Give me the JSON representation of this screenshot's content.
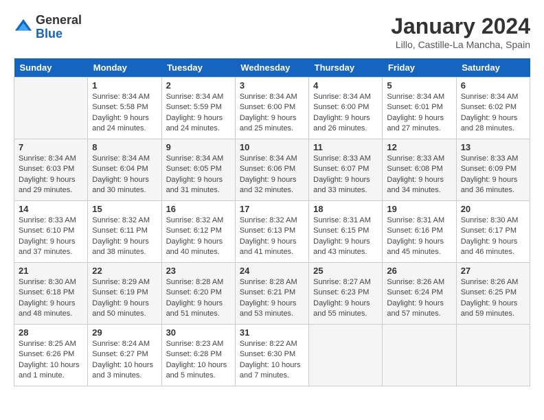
{
  "header": {
    "logo_general": "General",
    "logo_blue": "Blue",
    "title": "January 2024",
    "subtitle": "Lillo, Castille-La Mancha, Spain"
  },
  "calendar": {
    "days_of_week": [
      "Sunday",
      "Monday",
      "Tuesday",
      "Wednesday",
      "Thursday",
      "Friday",
      "Saturday"
    ],
    "weeks": [
      [
        {
          "day": "",
          "sunrise": "",
          "sunset": "",
          "daylight": ""
        },
        {
          "day": "1",
          "sunrise": "Sunrise: 8:34 AM",
          "sunset": "Sunset: 5:58 PM",
          "daylight": "Daylight: 9 hours and 24 minutes."
        },
        {
          "day": "2",
          "sunrise": "Sunrise: 8:34 AM",
          "sunset": "Sunset: 5:59 PM",
          "daylight": "Daylight: 9 hours and 24 minutes."
        },
        {
          "day": "3",
          "sunrise": "Sunrise: 8:34 AM",
          "sunset": "Sunset: 6:00 PM",
          "daylight": "Daylight: 9 hours and 25 minutes."
        },
        {
          "day": "4",
          "sunrise": "Sunrise: 8:34 AM",
          "sunset": "Sunset: 6:00 PM",
          "daylight": "Daylight: 9 hours and 26 minutes."
        },
        {
          "day": "5",
          "sunrise": "Sunrise: 8:34 AM",
          "sunset": "Sunset: 6:01 PM",
          "daylight": "Daylight: 9 hours and 27 minutes."
        },
        {
          "day": "6",
          "sunrise": "Sunrise: 8:34 AM",
          "sunset": "Sunset: 6:02 PM",
          "daylight": "Daylight: 9 hours and 28 minutes."
        }
      ],
      [
        {
          "day": "7",
          "sunrise": "Sunrise: 8:34 AM",
          "sunset": "Sunset: 6:03 PM",
          "daylight": "Daylight: 9 hours and 29 minutes."
        },
        {
          "day": "8",
          "sunrise": "Sunrise: 8:34 AM",
          "sunset": "Sunset: 6:04 PM",
          "daylight": "Daylight: 9 hours and 30 minutes."
        },
        {
          "day": "9",
          "sunrise": "Sunrise: 8:34 AM",
          "sunset": "Sunset: 6:05 PM",
          "daylight": "Daylight: 9 hours and 31 minutes."
        },
        {
          "day": "10",
          "sunrise": "Sunrise: 8:34 AM",
          "sunset": "Sunset: 6:06 PM",
          "daylight": "Daylight: 9 hours and 32 minutes."
        },
        {
          "day": "11",
          "sunrise": "Sunrise: 8:33 AM",
          "sunset": "Sunset: 6:07 PM",
          "daylight": "Daylight: 9 hours and 33 minutes."
        },
        {
          "day": "12",
          "sunrise": "Sunrise: 8:33 AM",
          "sunset": "Sunset: 6:08 PM",
          "daylight": "Daylight: 9 hours and 34 minutes."
        },
        {
          "day": "13",
          "sunrise": "Sunrise: 8:33 AM",
          "sunset": "Sunset: 6:09 PM",
          "daylight": "Daylight: 9 hours and 36 minutes."
        }
      ],
      [
        {
          "day": "14",
          "sunrise": "Sunrise: 8:33 AM",
          "sunset": "Sunset: 6:10 PM",
          "daylight": "Daylight: 9 hours and 37 minutes."
        },
        {
          "day": "15",
          "sunrise": "Sunrise: 8:32 AM",
          "sunset": "Sunset: 6:11 PM",
          "daylight": "Daylight: 9 hours and 38 minutes."
        },
        {
          "day": "16",
          "sunrise": "Sunrise: 8:32 AM",
          "sunset": "Sunset: 6:12 PM",
          "daylight": "Daylight: 9 hours and 40 minutes."
        },
        {
          "day": "17",
          "sunrise": "Sunrise: 8:32 AM",
          "sunset": "Sunset: 6:13 PM",
          "daylight": "Daylight: 9 hours and 41 minutes."
        },
        {
          "day": "18",
          "sunrise": "Sunrise: 8:31 AM",
          "sunset": "Sunset: 6:15 PM",
          "daylight": "Daylight: 9 hours and 43 minutes."
        },
        {
          "day": "19",
          "sunrise": "Sunrise: 8:31 AM",
          "sunset": "Sunset: 6:16 PM",
          "daylight": "Daylight: 9 hours and 45 minutes."
        },
        {
          "day": "20",
          "sunrise": "Sunrise: 8:30 AM",
          "sunset": "Sunset: 6:17 PM",
          "daylight": "Daylight: 9 hours and 46 minutes."
        }
      ],
      [
        {
          "day": "21",
          "sunrise": "Sunrise: 8:30 AM",
          "sunset": "Sunset: 6:18 PM",
          "daylight": "Daylight: 9 hours and 48 minutes."
        },
        {
          "day": "22",
          "sunrise": "Sunrise: 8:29 AM",
          "sunset": "Sunset: 6:19 PM",
          "daylight": "Daylight: 9 hours and 50 minutes."
        },
        {
          "day": "23",
          "sunrise": "Sunrise: 8:28 AM",
          "sunset": "Sunset: 6:20 PM",
          "daylight": "Daylight: 9 hours and 51 minutes."
        },
        {
          "day": "24",
          "sunrise": "Sunrise: 8:28 AM",
          "sunset": "Sunset: 6:21 PM",
          "daylight": "Daylight: 9 hours and 53 minutes."
        },
        {
          "day": "25",
          "sunrise": "Sunrise: 8:27 AM",
          "sunset": "Sunset: 6:23 PM",
          "daylight": "Daylight: 9 hours and 55 minutes."
        },
        {
          "day": "26",
          "sunrise": "Sunrise: 8:26 AM",
          "sunset": "Sunset: 6:24 PM",
          "daylight": "Daylight: 9 hours and 57 minutes."
        },
        {
          "day": "27",
          "sunrise": "Sunrise: 8:26 AM",
          "sunset": "Sunset: 6:25 PM",
          "daylight": "Daylight: 9 hours and 59 minutes."
        }
      ],
      [
        {
          "day": "28",
          "sunrise": "Sunrise: 8:25 AM",
          "sunset": "Sunset: 6:26 PM",
          "daylight": "Daylight: 10 hours and 1 minute."
        },
        {
          "day": "29",
          "sunrise": "Sunrise: 8:24 AM",
          "sunset": "Sunset: 6:27 PM",
          "daylight": "Daylight: 10 hours and 3 minutes."
        },
        {
          "day": "30",
          "sunrise": "Sunrise: 8:23 AM",
          "sunset": "Sunset: 6:28 PM",
          "daylight": "Daylight: 10 hours and 5 minutes."
        },
        {
          "day": "31",
          "sunrise": "Sunrise: 8:22 AM",
          "sunset": "Sunset: 6:30 PM",
          "daylight": "Daylight: 10 hours and 7 minutes."
        },
        {
          "day": "",
          "sunrise": "",
          "sunset": "",
          "daylight": ""
        },
        {
          "day": "",
          "sunrise": "",
          "sunset": "",
          "daylight": ""
        },
        {
          "day": "",
          "sunrise": "",
          "sunset": "",
          "daylight": ""
        }
      ]
    ]
  }
}
